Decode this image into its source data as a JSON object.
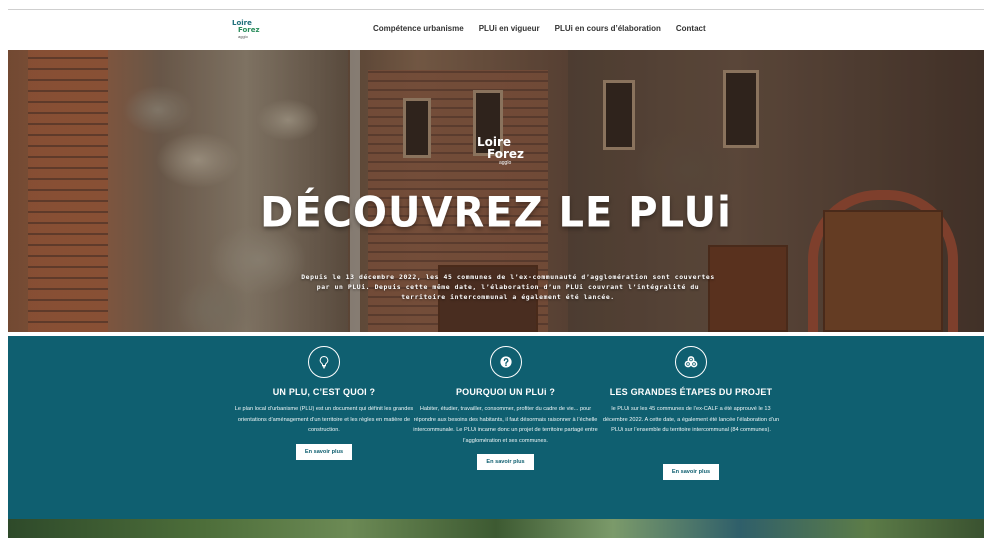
{
  "header": {
    "logo": {
      "line1": "Loire",
      "line2": "Forez",
      "line3": "agglo"
    },
    "menu": [
      {
        "label": "Compétence urbanisme"
      },
      {
        "label": "PLUi en vigueur"
      },
      {
        "label": "PLUi en cours d’élaboration"
      },
      {
        "label": "Contact"
      }
    ]
  },
  "hero": {
    "logo": {
      "line1": "Loire",
      "line2": "Forez",
      "line3": "agglo"
    },
    "title": "DÉCOUVREZ LE PLUi",
    "text": "Depuis le 13 décembre 2022, les 45 communes de l’ex-communauté d’agglomération sont couvertes par un PLUi. Depuis cette même date, l’élaboration d’un PLUi couvrant l’intégralité du territoire intercommunal a également été lancée."
  },
  "cards": [
    {
      "icon": "lightbulb-icon",
      "title": "UN PLU, C’EST QUOI ?",
      "text": "Le plan local d’urbanisme (PLU) est un document qui définit les grandes orientations d’aménagement d’un territoire et les règles en matière de construction.",
      "button": "En savoir plus"
    },
    {
      "icon": "question-icon",
      "title": "POURQUOI UN PLUi ?",
      "text": "Habiter, étudier, travailler, consommer, profiter du cadre de vie... pour répondre aux besoins des habitants, il faut désormais raisonner à l’échelle intercommunale. Le PLUi incarne donc un projet de territoire partagé entre l’agglomération et ses communes.",
      "button": "En savoir plus"
    },
    {
      "icon": "coins-icon",
      "title": "LES GRANDES ÉTAPES DU PROJET",
      "text": "le PLUi sur les 45 communes de l’ex-CALF a été approuvé le 13 décembre 2022. A cette date, a également été lancée l’élaboration d’un PLUi sur l’ensemble du territoire intercommunal (84 communes).",
      "button": "En savoir plus"
    }
  ],
  "colors": {
    "teal": "#0f5f70",
    "logo_teal": "#1f6f7a",
    "logo_green": "#2a8d5c"
  }
}
